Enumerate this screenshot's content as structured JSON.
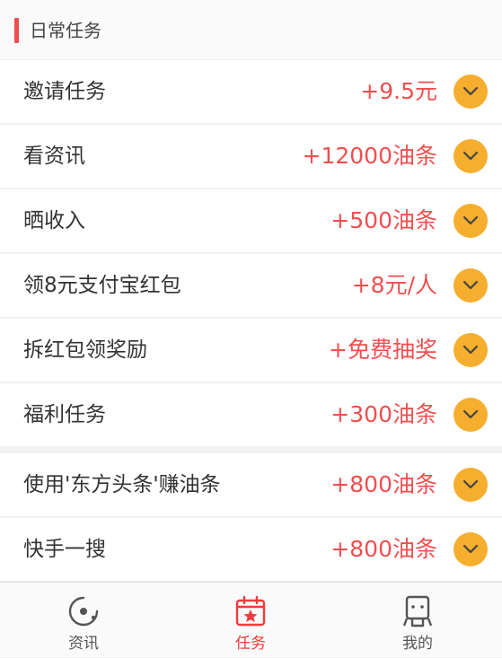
{
  "section": {
    "title": "日常任务"
  },
  "tasks": [
    {
      "label": "邀请任务",
      "reward": "+9.5元"
    },
    {
      "label": "看资讯",
      "reward": "+12000油条"
    },
    {
      "label": "晒收入",
      "reward": "+500油条"
    },
    {
      "label": "领8元支付宝红包",
      "reward": "+8元/人"
    },
    {
      "label": "拆红包领奖励",
      "reward": "+免费抽奖"
    },
    {
      "label": "福利任务",
      "reward": "+300油条"
    },
    {
      "label": "使用'东方头条'赚油条",
      "reward": "+800油条"
    },
    {
      "label": "快手一搜",
      "reward": "+800油条"
    }
  ],
  "tabbar": {
    "items": [
      {
        "label": "资讯",
        "icon": "news-icon"
      },
      {
        "label": "任务",
        "icon": "calendar-star-icon",
        "active": true
      },
      {
        "label": "我的",
        "icon": "profile-icon"
      }
    ]
  },
  "colors": {
    "accent_red": "#ef4f4f",
    "expand_button": "#f5ae2e",
    "section_bar": "#f24d4d"
  }
}
